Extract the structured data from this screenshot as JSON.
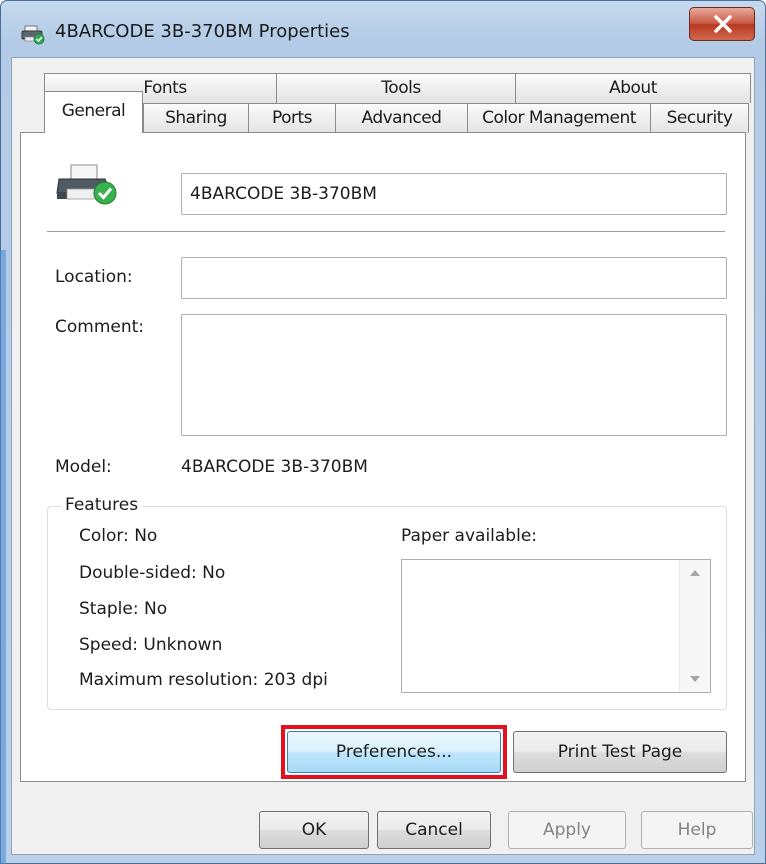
{
  "window": {
    "title": "4BARCODE 3B-370BM Properties"
  },
  "tabs": {
    "row_back": [
      {
        "label": "Fonts"
      },
      {
        "label": "Tools"
      },
      {
        "label": "About"
      }
    ],
    "row_front": [
      {
        "label": "General",
        "active": true
      },
      {
        "label": "Sharing"
      },
      {
        "label": "Ports"
      },
      {
        "label": "Advanced"
      },
      {
        "label": "Color Management"
      },
      {
        "label": "Security"
      }
    ]
  },
  "general": {
    "printer_name": "4BARCODE 3B-370BM",
    "location_label": "Location:",
    "location_value": "",
    "comment_label": "Comment:",
    "comment_value": "",
    "model_label": "Model:",
    "model_value": "4BARCODE 3B-370BM",
    "features": {
      "legend": "Features",
      "color": "Color: No",
      "double_sided": "Double-sided: No",
      "staple": "Staple: No",
      "speed": "Speed: Unknown",
      "max_resolution": "Maximum resolution: 203 dpi",
      "paper_available_label": "Paper available:"
    },
    "preferences_button": "Preferences...",
    "print_test_button": "Print Test Page"
  },
  "footer": {
    "ok": "OK",
    "cancel": "Cancel",
    "apply": "Apply",
    "help": "Help"
  },
  "colors": {
    "highlight": "#e3101e",
    "close_button": "#c85a44",
    "title_bar": "#b9d0ea"
  },
  "icons": {
    "title": "printer-check-icon",
    "printer": "printer-check-icon",
    "close": "close-icon"
  }
}
